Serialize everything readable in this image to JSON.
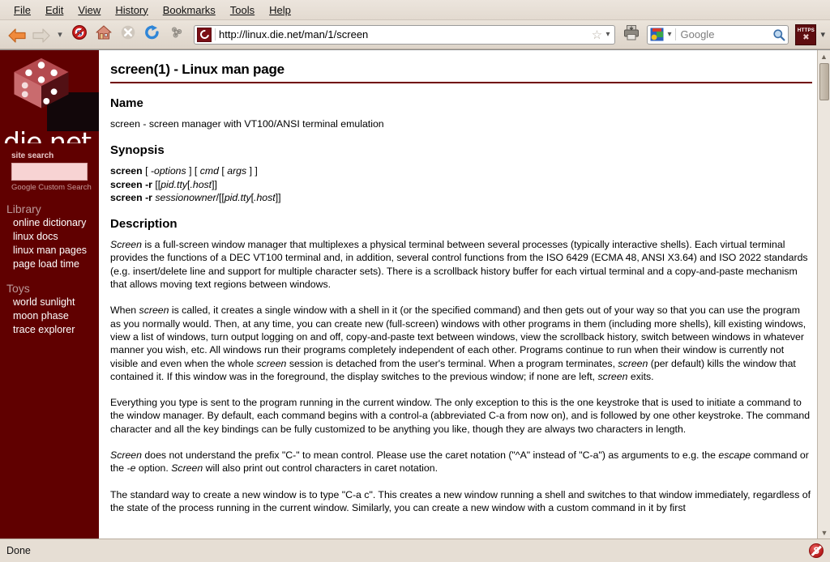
{
  "menubar": {
    "items": [
      "File",
      "Edit",
      "View",
      "History",
      "Bookmarks",
      "Tools",
      "Help"
    ]
  },
  "toolbar": {
    "back_icon": "back-arrow-icon",
    "forward_icon": "forward-arrow-icon",
    "dropdown_icon": "chevron-down-icon",
    "noscript_icon": "noscript-icon",
    "home_icon": "home-icon",
    "stop_icon": "stop-icon",
    "reload_icon": "reload-icon",
    "extension_icon": "molecule-icon",
    "url": "http://linux.die.net/man/1/screen",
    "url_favicon": "die-net-favicon",
    "bookmark_star_icon": "star-icon",
    "print_icon": "printer-icon",
    "search_engine": "Google",
    "search_engine_icon": "google-icon",
    "search_magnifier_icon": "magnifier-icon",
    "https_label": "HTTPS",
    "https_glyph": "✖",
    "https_name": "https-everywhere-button"
  },
  "sidebar": {
    "logo_text": "die.net",
    "logo_icon": "red-dice-logo",
    "site_search_label": "site search",
    "site_search_value": "",
    "google_custom_search": "Google Custom Search",
    "sections": [
      {
        "heading": "Library",
        "links": [
          "online dictionary",
          "linux docs",
          "linux man pages",
          "page load time"
        ]
      },
      {
        "heading": "Toys",
        "links": [
          "world sunlight",
          "moon phase",
          "trace explorer"
        ]
      }
    ]
  },
  "content": {
    "title": "screen(1) - Linux man page",
    "sections": [
      {
        "heading": "Name"
      },
      {
        "heading": "Synopsis"
      },
      {
        "heading": "Description"
      }
    ],
    "name_text": "screen - screen manager with VT100/ANSI terminal emulation",
    "synopsis": [
      {
        "cmd": "screen",
        "rest_parts": [
          {
            "t": " [ ",
            "i": false
          },
          {
            "t": "-options",
            "i": true
          },
          {
            "t": " ] [ ",
            "i": false
          },
          {
            "t": "cmd",
            "i": true
          },
          {
            "t": " [ ",
            "i": false
          },
          {
            "t": "args",
            "i": true
          },
          {
            "t": " ] ]",
            "i": false
          }
        ]
      },
      {
        "cmd": "screen -r",
        "rest_parts": [
          {
            "t": " [[",
            "i": false
          },
          {
            "t": "pid.",
            "i": true
          },
          {
            "t": "tty",
            "i": true
          },
          {
            "t": "[",
            "i": false
          },
          {
            "t": ".host",
            "i": true
          },
          {
            "t": "]]",
            "i": false
          }
        ]
      },
      {
        "cmd": "screen -r",
        "rest_parts": [
          {
            "t": " sessionowner",
            "i": true
          },
          {
            "t": "/[[",
            "i": false
          },
          {
            "t": "pid.",
            "i": true
          },
          {
            "t": "tty",
            "i": true
          },
          {
            "t": "[",
            "i": false
          },
          {
            "t": ".host",
            "i": true
          },
          {
            "t": "]]",
            "i": false
          }
        ]
      }
    ],
    "paragraphs": [
      [
        {
          "t": "Screen",
          "i": true
        },
        {
          "t": " is a full-screen window manager that multiplexes a physical terminal between several processes (typically interactive shells). Each virtual terminal provides the functions of a DEC VT100 terminal and, in addition, several control functions from the ISO 6429 (ECMA 48, ANSI X3.64) and ISO 2022 standards (e.g. insert/delete line and support for multiple character sets). There is a scrollback history buffer for each virtual terminal and a copy-and-paste mechanism that allows moving text regions between windows.",
          "i": false
        }
      ],
      [
        {
          "t": "When ",
          "i": false
        },
        {
          "t": "screen",
          "i": true
        },
        {
          "t": " is called, it creates a single window with a shell in it (or the specified command) and then gets out of your way so that you can use the program as you normally would. Then, at any time, you can create new (full-screen) windows with other programs in them (including more shells), kill existing windows, view a list of windows, turn output logging on and off, copy-and-paste text between windows, view the scrollback history, switch between windows in whatever manner you wish, etc. All windows run their programs completely independent of each other. Programs continue to run when their window is currently not visible and even when the whole ",
          "i": false
        },
        {
          "t": "screen",
          "i": true
        },
        {
          "t": " session is detached from the user's terminal. When a program terminates, ",
          "i": false
        },
        {
          "t": "screen",
          "i": true
        },
        {
          "t": " (per default) kills the window that contained it. If this window was in the foreground, the display switches to the previous window; if none are left, ",
          "i": false
        },
        {
          "t": "screen",
          "i": true
        },
        {
          "t": " exits.",
          "i": false
        }
      ],
      [
        {
          "t": "Everything you type is sent to the program running in the current window. The only exception to this is the one keystroke that is used to initiate a command to the window manager. By default, each command begins with a control-a (abbreviated C-a from now on), and is followed by one other keystroke. The command character and all the key bindings can be fully customized to be anything you like, though they are always two characters in length.",
          "i": false
        }
      ],
      [
        {
          "t": "Screen",
          "i": true
        },
        {
          "t": " does not understand the prefix \"C-\" to mean control. Please use the caret notation (\"^A\" instead of \"C-a\") as arguments to e.g. the ",
          "i": false
        },
        {
          "t": "escape",
          "i": true
        },
        {
          "t": " command or the ",
          "i": false
        },
        {
          "t": "-e",
          "i": true
        },
        {
          "t": " option. ",
          "i": false
        },
        {
          "t": "Screen",
          "i": true
        },
        {
          "t": " will also print out control characters in caret notation.",
          "i": false
        }
      ],
      [
        {
          "t": "The standard way to create a new window is to type \"C-a c\". This creates a new window running a shell and switches to that window immediately, regardless of the state of the process running in the current window. Similarly, you can create a new window with a custom command in it by first",
          "i": false
        }
      ]
    ]
  },
  "statusbar": {
    "text": "Done",
    "noscript_icon": "noscript-status-icon"
  },
  "scrollbar": {
    "up_arrow": "▲",
    "down_arrow": "▼"
  },
  "colors": {
    "sidebar_bg": "#600000",
    "title_rule": "#700000",
    "chrome_bg": "#e8e0d8"
  }
}
